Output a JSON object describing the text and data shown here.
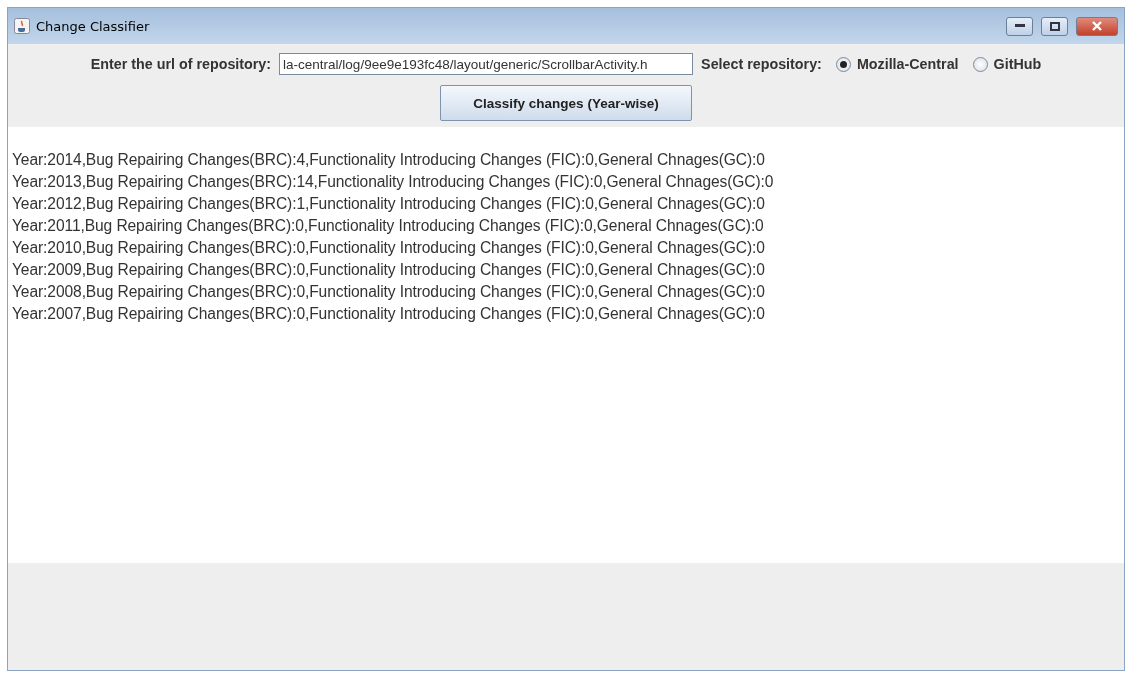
{
  "window": {
    "title": "Change Classifier"
  },
  "form": {
    "url_label": "Enter the url of repository:",
    "url_value": "la-central/log/9ee9e193fc48/layout/generic/ScrollbarActivity.h",
    "repo_label": "Select repository:",
    "repositories": [
      {
        "label": "Mozilla-Central",
        "selected": true
      },
      {
        "label": "GitHub",
        "selected": false
      }
    ],
    "button": "Classify changes (Year-wise)"
  },
  "output_lines": [
    "Year:2014,Bug Repairing Changes(BRC):4,Functionality Introducing Changes (FIC):0,General Chnages(GC):0",
    "Year:2013,Bug Repairing Changes(BRC):14,Functionality Introducing Changes (FIC):0,General Chnages(GC):0",
    "Year:2012,Bug Repairing Changes(BRC):1,Functionality Introducing Changes (FIC):0,General Chnages(GC):0",
    "Year:2011,Bug Repairing Changes(BRC):0,Functionality Introducing Changes (FIC):0,General Chnages(GC):0",
    "Year:2010,Bug Repairing Changes(BRC):0,Functionality Introducing Changes (FIC):0,General Chnages(GC):0",
    "Year:2009,Bug Repairing Changes(BRC):0,Functionality Introducing Changes (FIC):0,General Chnages(GC):0",
    "Year:2008,Bug Repairing Changes(BRC):0,Functionality Introducing Changes (FIC):0,General Chnages(GC):0",
    "Year:2007,Bug Repairing Changes(BRC):0,Functionality Introducing Changes (FIC):0,General Chnages(GC):0"
  ]
}
